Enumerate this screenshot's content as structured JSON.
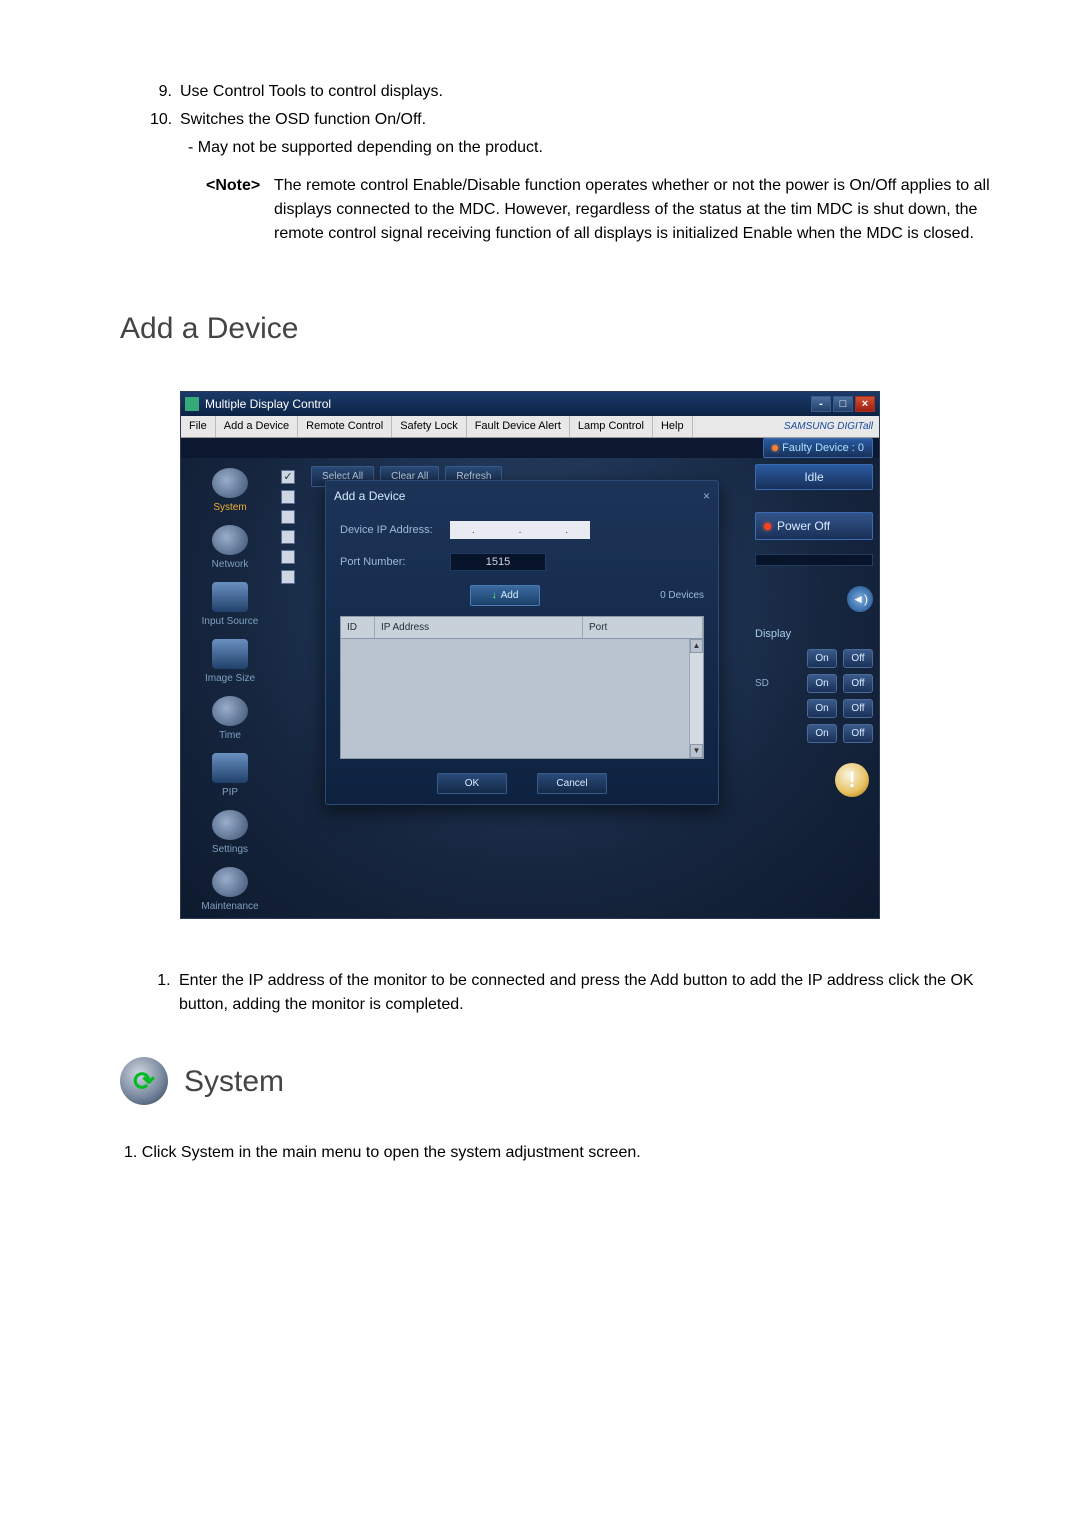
{
  "top_items": [
    {
      "num": "9.",
      "text": "Use Control Tools to control displays."
    },
    {
      "num": "10.",
      "text": "Switches the OSD function On/Off."
    }
  ],
  "top_sub": "- May not be supported depending on the product.",
  "note_label": "<Note>",
  "note_text": "The remote control Enable/Disable function operates whether or not the power is On/Off applies to all displays connected to the MDC. However, regardless of the status at the tim MDC is shut down, the remote control signal receiving function of all displays is initialized Enable when the MDC is closed.",
  "add_heading": "Add a Device",
  "app": {
    "title": "Multiple Display Control",
    "menu": [
      "File",
      "Add a Device",
      "Remote Control",
      "Safety Lock",
      "Fault Device Alert",
      "Lamp Control",
      "Help"
    ],
    "brand": "SAMSUNG DIGITall",
    "faulty": "Faulty Device : 0",
    "sidebar": [
      {
        "label": "System",
        "active": true
      },
      {
        "label": "Network"
      },
      {
        "label": "Input Source"
      },
      {
        "label": "Image Size"
      },
      {
        "label": "Time"
      },
      {
        "label": "PIP"
      },
      {
        "label": "Settings"
      },
      {
        "label": "Maintenance"
      }
    ],
    "toolbar": [
      "Select All",
      "Clear All",
      "Refresh"
    ],
    "right": {
      "idle": "Idle",
      "power": "Power Off",
      "display_label": "Display",
      "sd_label": "SD",
      "on": "On",
      "off": "Off"
    },
    "dialog": {
      "title": "Add a Device",
      "ip_label": "Device IP Address:",
      "port_label": "Port Number:",
      "port_value": "1515",
      "add_btn": "Add",
      "dev_count": "0 Devices",
      "col_id": "ID",
      "col_ip": "IP Address",
      "col_port": "Port",
      "ok": "OK",
      "cancel": "Cancel"
    }
  },
  "step1": "Enter the IP address of the monitor to be connected and press the Add button to add the IP address click the OK button, adding the monitor is completed.",
  "system_heading": "System",
  "system_step1": "1. Click System in the main menu to open the system adjustment screen."
}
